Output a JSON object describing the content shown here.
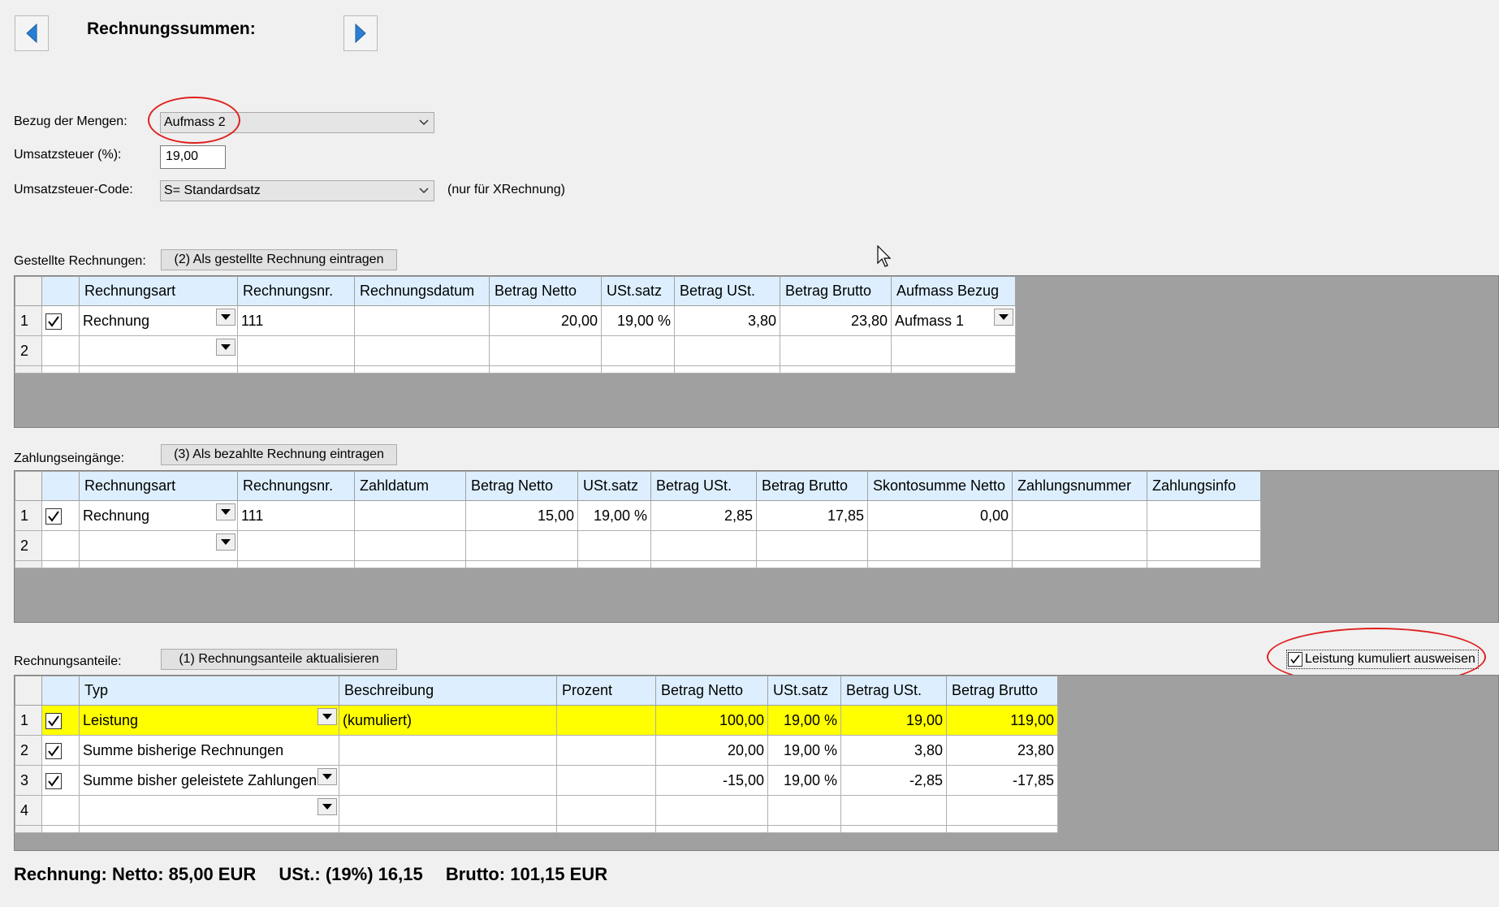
{
  "header": {
    "title": "Rechnungssummen:",
    "prev_icon": "triangle-left-icon",
    "next_icon": "triangle-right-icon"
  },
  "form": {
    "bezug_label": "Bezug der Mengen:",
    "bezug_value": "Aufmass 2",
    "ust_label": "Umsatzsteuer (%):",
    "ust_value": "19,00",
    "code_label": "Umsatzsteuer-Code:",
    "code_value": "S= Standardsatz",
    "code_hint": "(nur für XRechnung)"
  },
  "gestellt": {
    "label": "Gestellte Rechnungen:",
    "button": "(2) Als gestellte Rechnung eintragen",
    "columns": [
      "Rechnungsart",
      "Rechnungsnr.",
      "Rechnungsdatum",
      "Betrag Netto",
      "USt.satz",
      "Betrag USt.",
      "Betrag Brutto",
      "Aufmass Bezug"
    ],
    "rows": [
      {
        "num": "1",
        "checked": true,
        "art": "Rechnung",
        "nr": "111",
        "datum": "",
        "netto": "20,00",
        "satz": "19,00 %",
        "ust": "3,80",
        "brutto": "23,80",
        "bezug": "Aufmass 1"
      },
      {
        "num": "2",
        "checked": false,
        "art": "",
        "nr": "",
        "datum": "",
        "netto": "",
        "satz": "",
        "ust": "",
        "brutto": "",
        "bezug": ""
      }
    ]
  },
  "zahlungen": {
    "label": "Zahlungseingänge:",
    "button": "(3) Als bezahlte Rechnung eintragen",
    "columns": [
      "Rechnungsart",
      "Rechnungsnr.",
      "Zahldatum",
      "Betrag Netto",
      "USt.satz",
      "Betrag USt.",
      "Betrag Brutto",
      "Skontosumme Netto",
      "Zahlungsnummer",
      "Zahlungsinfo"
    ],
    "rows": [
      {
        "num": "1",
        "checked": true,
        "art": "Rechnung",
        "nr": "111",
        "datum": "",
        "netto": "15,00",
        "satz": "19,00 %",
        "ust": "2,85",
        "brutto": "17,85",
        "skonto": "0,00",
        "znr": "",
        "zinfo": ""
      },
      {
        "num": "2",
        "checked": false,
        "art": "",
        "nr": "",
        "datum": "",
        "netto": "",
        "satz": "",
        "ust": "",
        "brutto": "",
        "skonto": "",
        "znr": "",
        "zinfo": ""
      }
    ]
  },
  "anteile": {
    "label": "Rechnungsanteile:",
    "button": "(1) Rechnungsanteile aktualisieren",
    "cumulative_label": "Leistung kumuliert ausweisen",
    "cumulative_checked": true,
    "columns": [
      "Typ",
      "Beschreibung",
      "Prozent",
      "Betrag Netto",
      "USt.satz",
      "Betrag USt.",
      "Betrag Brutto"
    ],
    "rows": [
      {
        "num": "1",
        "checked": true,
        "typ": "Leistung",
        "beschr": "(kumuliert)",
        "prozent": "",
        "netto": "100,00",
        "satz": "19,00 %",
        "ust": "19,00",
        "brutto": "119,00"
      },
      {
        "num": "2",
        "checked": true,
        "typ": "Summe bisherige Rechnungen",
        "beschr": "",
        "prozent": "",
        "netto": "20,00",
        "satz": "19,00 %",
        "ust": "3,80",
        "brutto": "23,80"
      },
      {
        "num": "3",
        "checked": true,
        "typ": "Summe bisher geleistete Zahlungen",
        "beschr": "",
        "prozent": "",
        "netto": "-15,00",
        "satz": "19,00 %",
        "ust": "-2,85",
        "brutto": "-17,85"
      },
      {
        "num": "4",
        "checked": false,
        "typ": "",
        "beschr": "",
        "prozent": "",
        "netto": "",
        "satz": "",
        "ust": "",
        "brutto": ""
      }
    ]
  },
  "summary": {
    "rechnung": "Rechnung: Netto: 85,00 EUR",
    "ust": "USt.: (19%) 16,15",
    "brutto": "Brutto: 101,15 EUR"
  },
  "colors": {
    "highlight": "#ffff00",
    "header_bg": "#ddefff",
    "annotation": "#e02020",
    "panel_bg": "#a0a0a0"
  }
}
